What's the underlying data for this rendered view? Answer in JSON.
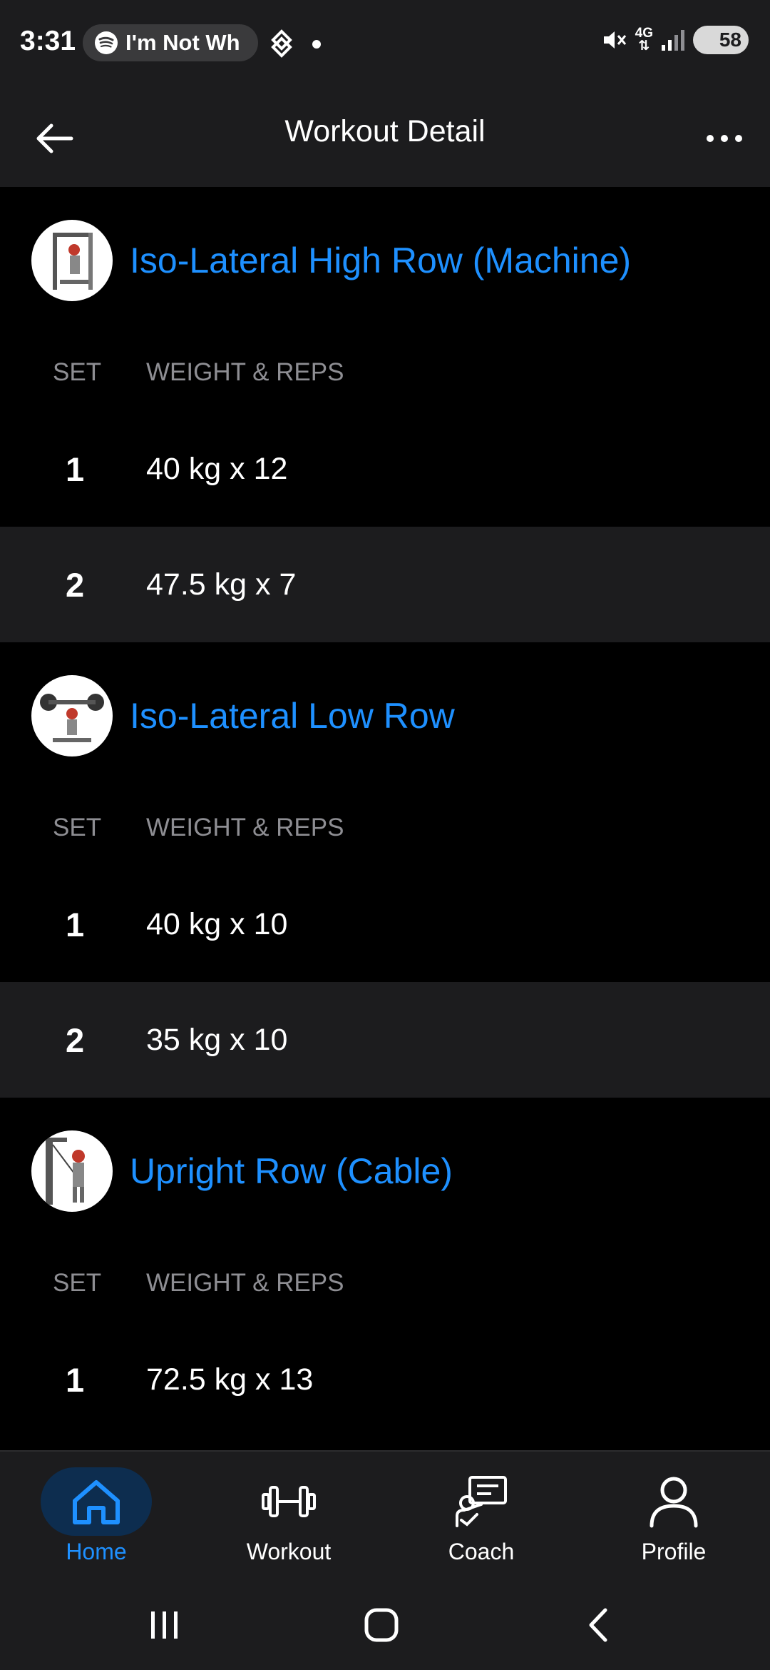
{
  "status_bar": {
    "time": "3:31",
    "media_pill_text": "I'm Not Wh",
    "network": "4G",
    "battery": "58"
  },
  "header": {
    "title": "Workout Detail"
  },
  "columns": {
    "set": "SET",
    "weight_reps": "WEIGHT & REPS"
  },
  "exercises": [
    {
      "name": "Iso-Lateral High Row (Machine)",
      "sets": [
        {
          "num": "1",
          "value": "40 kg x 12"
        },
        {
          "num": "2",
          "value": "47.5 kg x 7"
        }
      ]
    },
    {
      "name": "Iso-Lateral Low Row",
      "sets": [
        {
          "num": "1",
          "value": "40 kg x 10"
        },
        {
          "num": "2",
          "value": "35 kg x 10"
        }
      ]
    },
    {
      "name": "Upright Row (Cable)",
      "sets": [
        {
          "num": "1",
          "value": "72.5 kg x 13"
        }
      ]
    }
  ],
  "bottom_nav": {
    "items": [
      {
        "label": "Home",
        "icon": "home-icon",
        "active": true
      },
      {
        "label": "Workout",
        "icon": "dumbbell-icon",
        "active": false
      },
      {
        "label": "Coach",
        "icon": "coach-icon",
        "active": false
      },
      {
        "label": "Profile",
        "icon": "profile-icon",
        "active": false
      }
    ]
  },
  "colors": {
    "accent": "#1e90ff",
    "background": "#000000",
    "surface": "#1c1c1e",
    "muted_text": "#8e8e93"
  }
}
